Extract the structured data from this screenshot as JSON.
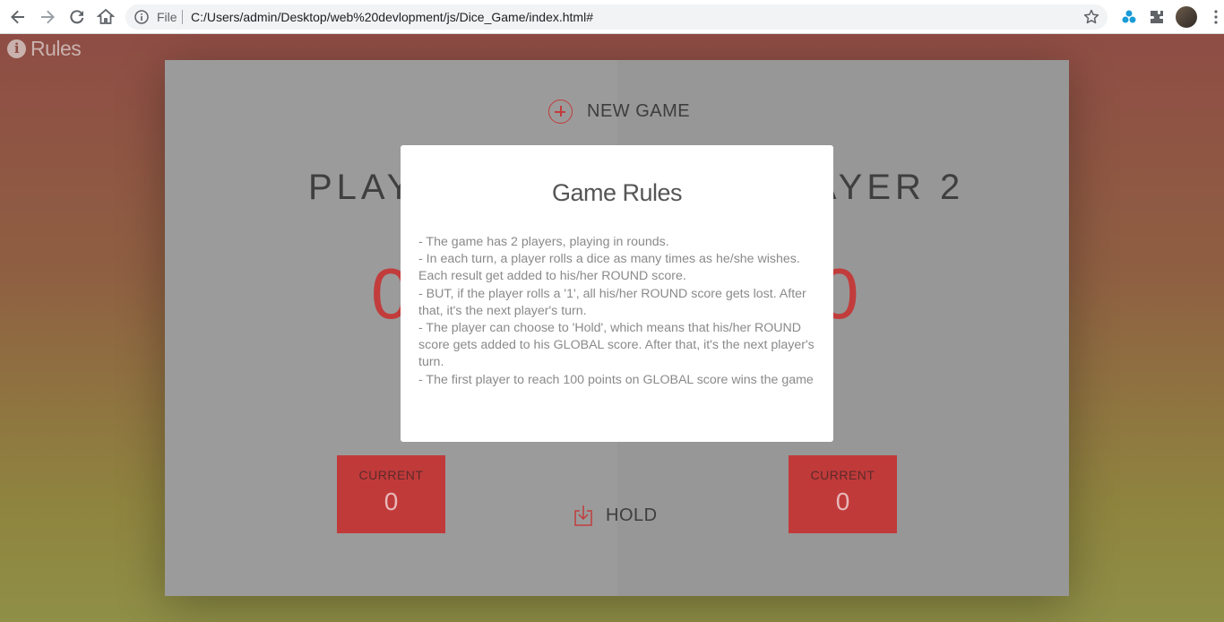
{
  "browser": {
    "file_label": "File",
    "url": "C:/Users/admin/Desktop/web%20devlopment/js/Dice_Game/index.html#"
  },
  "page": {
    "rules_link": "Rules",
    "new_game": "NEW GAME",
    "hold": "HOLD",
    "players": [
      {
        "name": "PLAYER 1",
        "score": "0",
        "current_label": "CURRENT",
        "current_score": "0"
      },
      {
        "name": "PLAYER 2",
        "score": "0",
        "current_label": "CURRENT",
        "current_score": "0"
      }
    ]
  },
  "modal": {
    "title": "Game Rules",
    "rules": [
      "- The game has 2 players, playing in rounds.",
      "- In each turn, a player rolls a dice as many times as he/she wishes. Each result get added to his/her ROUND score.",
      "- BUT, if the player rolls a '1', all his/her ROUND score gets lost. After that, it's the next player's turn.",
      "- The player can choose to 'Hold', which means that his/her ROUND score gets added to his GLOBAL score. After that, it's the next player's turn.",
      "- The first player to reach 100 points on GLOBAL score wins the game"
    ]
  },
  "colors": {
    "accent_red": "#c23c3c",
    "gradient_top": "#8f4d45",
    "gradient_bottom": "#8f8f47"
  },
  "icons": [
    "back-arrow-icon",
    "forward-arrow-icon",
    "reload-icon",
    "home-icon",
    "info-icon",
    "star-icon",
    "extension-icon",
    "puzzle-icon",
    "add-circle-icon",
    "download-icon"
  ]
}
